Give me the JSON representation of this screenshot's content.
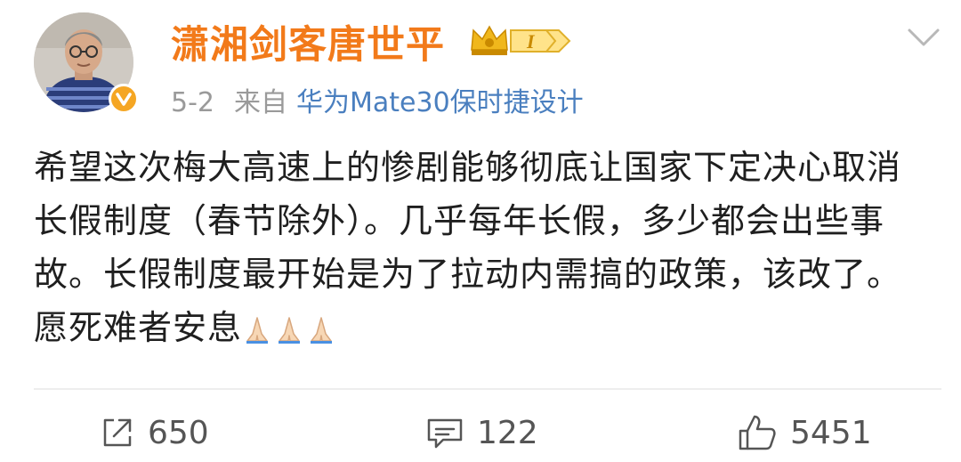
{
  "post": {
    "author": "潇湘剑客唐世平",
    "badge_text": "I",
    "date": "5-2",
    "from_label": "来自",
    "source": "华为Mate30保时捷设计",
    "text": "希望这次梅大高速上的惨剧能够彻底让国家下定决心取消长假制度（春节除外）。几乎每年长假，多少都会出些事故。长假制度最开始是为了拉动内需搞的政策，该改了。愿死难者安息",
    "emoji": "🙏🙏🙏"
  },
  "actions": {
    "repost_count": "650",
    "comment_count": "122",
    "like_count": "5451"
  },
  "colors": {
    "username": "#f27a1a",
    "source": "#4a7fbf",
    "verified": "#f5a623",
    "meta": "#9a9a9a"
  },
  "icons": {
    "verified": "verified-v-icon",
    "rank_badge": "crown-badge-icon",
    "expand": "chevron-down-icon",
    "repost": "repost-icon",
    "comment": "comment-icon",
    "like": "thumbs-up-icon"
  }
}
